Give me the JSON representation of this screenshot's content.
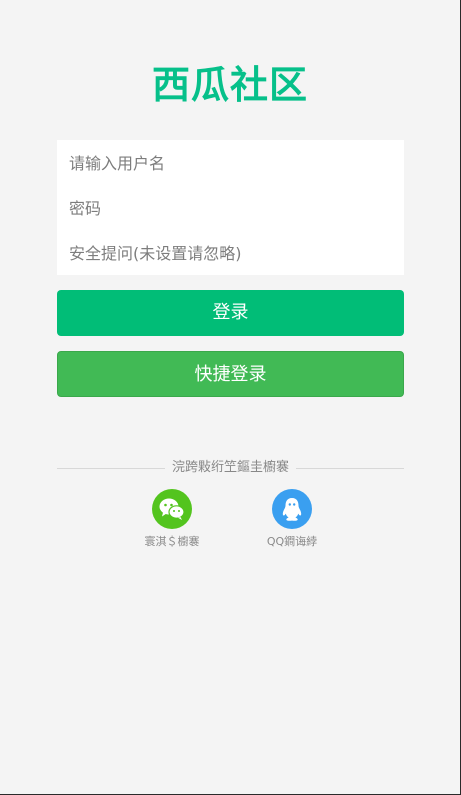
{
  "brand": {
    "logo_text": "西瓜社区",
    "accent": "#06c08a"
  },
  "form": {
    "username_placeholder": "请输入用户名",
    "password_placeholder": "密码",
    "security_placeholder": "安全提问(未设置请忽略)"
  },
  "buttons": {
    "login": {
      "label": "登录",
      "color": "#01bd77"
    },
    "quick_login": {
      "label": "快捷登录",
      "color": "#41ba55"
    }
  },
  "third_party": {
    "heading": "浣跨敤绗笁鏂圭櫥褰",
    "items": [
      {
        "label": "寰淇＄櫥褰",
        "icon": "wechat-icon",
        "color": "#53c41e"
      },
      {
        "label": "QQ鐧诲綍",
        "icon": "qq-icon",
        "color": "#3a9ff0"
      }
    ]
  }
}
